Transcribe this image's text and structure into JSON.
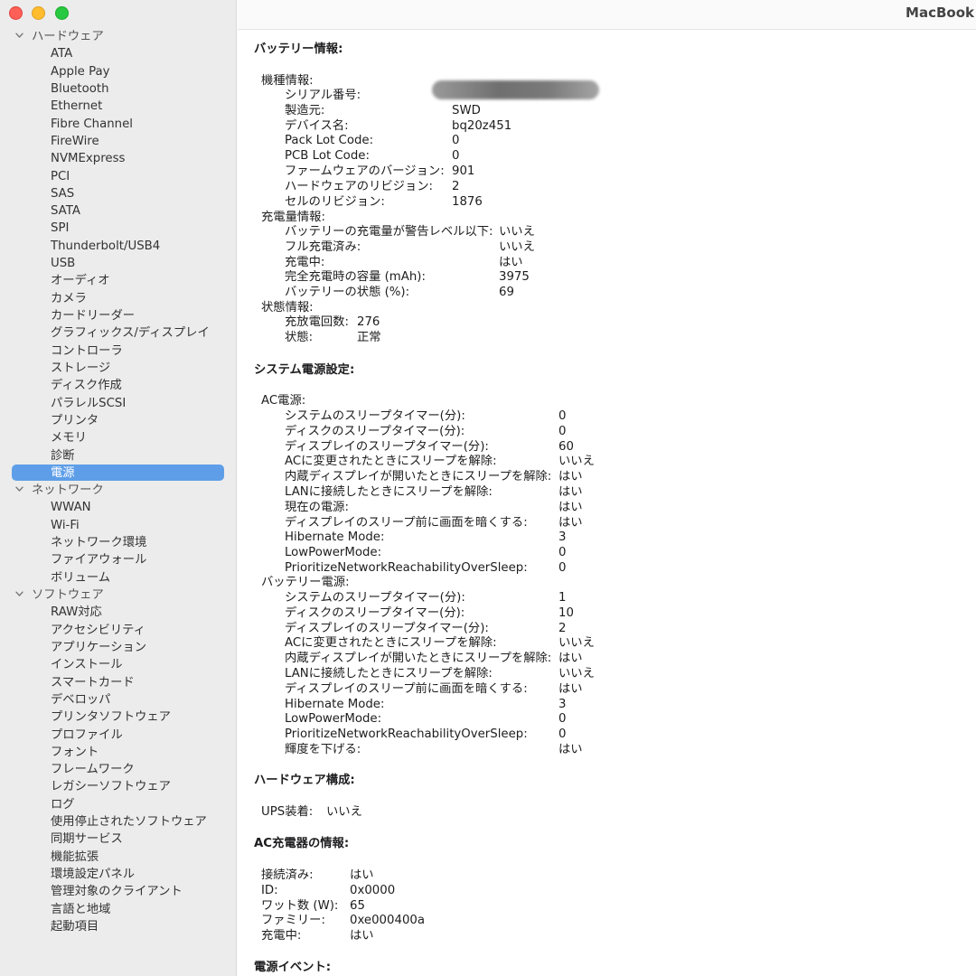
{
  "window": {
    "title": "MacBook"
  },
  "sidebar": {
    "groups": [
      {
        "label": "ハードウェア",
        "items": [
          "ATA",
          "Apple Pay",
          "Bluetooth",
          "Ethernet",
          "Fibre Channel",
          "FireWire",
          "NVMExpress",
          "PCI",
          "SAS",
          "SATA",
          "SPI",
          "Thunderbolt/USB4",
          "USB",
          "オーディオ",
          "カメラ",
          "カードリーダー",
          "グラフィックス/ディスプレイ",
          "コントローラ",
          "ストレージ",
          "ディスク作成",
          "パラレルSCSI",
          "プリンタ",
          "メモリ",
          "診断",
          "電源"
        ]
      },
      {
        "label": "ネットワーク",
        "items": [
          "WWAN",
          "Wi-Fi",
          "ネットワーク環境",
          "ファイアウォール",
          "ボリューム"
        ]
      },
      {
        "label": "ソフトウェア",
        "items": [
          "RAW対応",
          "アクセシビリティ",
          "アプリケーション",
          "インストール",
          "スマートカード",
          "デベロッパ",
          "プリンタソフトウェア",
          "プロファイル",
          "フォント",
          "フレームワーク",
          "レガシーソフトウェア",
          "ログ",
          "使用停止されたソフトウェア",
          "同期サービス",
          "機能拡張",
          "環境設定パネル",
          "管理対象のクライアント",
          "言語と地域",
          "起動項目"
        ]
      }
    ],
    "selected": "電源"
  },
  "battery": {
    "title": "バッテリー情報:",
    "model_header": "機種情報:",
    "model": [
      {
        "k": "シリアル番号:",
        "v": ""
      },
      {
        "k": "製造元:",
        "v": "SWD"
      },
      {
        "k": "デバイス名:",
        "v": "bq20z451"
      },
      {
        "k": "Pack Lot Code:",
        "v": "0"
      },
      {
        "k": "PCB Lot Code:",
        "v": "0"
      },
      {
        "k": "ファームウェアのバージョン:",
        "v": "901"
      },
      {
        "k": "ハードウェアのリビジョン:",
        "v": "2"
      },
      {
        "k": "セルのリビジョン:",
        "v": "1876"
      }
    ],
    "charge_header": "充電量情報:",
    "charge": [
      {
        "k": "バッテリーの充電量が警告レベル以下:",
        "v": "いいえ"
      },
      {
        "k": "フル充電済み:",
        "v": "いいえ"
      },
      {
        "k": "充電中:",
        "v": "はい"
      },
      {
        "k": "完全充電時の容量 (mAh):",
        "v": "3975"
      },
      {
        "k": "バッテリーの状態 (%):",
        "v": "69"
      }
    ],
    "status_header": "状態情報:",
    "status": [
      {
        "k": "充放電回数:",
        "v": "276"
      },
      {
        "k": "状態:",
        "v": "正常"
      }
    ]
  },
  "power": {
    "title": "システム電源設定:",
    "ac_header": "AC電源:",
    "ac": [
      {
        "k": "システムのスリープタイマー(分):",
        "v": "0"
      },
      {
        "k": "ディスクのスリープタイマー(分):",
        "v": "0"
      },
      {
        "k": "ディスプレイのスリープタイマー(分):",
        "v": "60"
      },
      {
        "k": "ACに変更されたときにスリープを解除:",
        "v": "いいえ"
      },
      {
        "k": "内蔵ディスプレイが開いたときにスリープを解除:",
        "v": "はい"
      },
      {
        "k": "LANに接続したときにスリープを解除:",
        "v": "はい"
      },
      {
        "k": "現在の電源:",
        "v": "はい"
      },
      {
        "k": "ディスプレイのスリープ前に画面を暗くする:",
        "v": "はい"
      },
      {
        "k": "Hibernate Mode:",
        "v": "3"
      },
      {
        "k": "LowPowerMode:",
        "v": "0"
      },
      {
        "k": "PrioritizeNetworkReachabilityOverSleep:",
        "v": "0"
      }
    ],
    "batt_header": "バッテリー電源:",
    "batt": [
      {
        "k": "システムのスリープタイマー(分):",
        "v": "1"
      },
      {
        "k": "ディスクのスリープタイマー(分):",
        "v": "10"
      },
      {
        "k": "ディスプレイのスリープタイマー(分):",
        "v": "2"
      },
      {
        "k": "ACに変更されたときにスリープを解除:",
        "v": "いいえ"
      },
      {
        "k": "内蔵ディスプレイが開いたときにスリープを解除:",
        "v": "はい"
      },
      {
        "k": "LANに接続したときにスリープを解除:",
        "v": "いいえ"
      },
      {
        "k": "ディスプレイのスリープ前に画面を暗くする:",
        "v": "はい"
      },
      {
        "k": "Hibernate Mode:",
        "v": "3"
      },
      {
        "k": "LowPowerMode:",
        "v": "0"
      },
      {
        "k": "PrioritizeNetworkReachabilityOverSleep:",
        "v": "0"
      },
      {
        "k": "輝度を下げる:",
        "v": "はい"
      }
    ]
  },
  "hardware": {
    "title": "ハードウェア構成:",
    "ups_label": "UPS装着:",
    "ups_value": "いいえ"
  },
  "charger": {
    "title": "AC充電器の情報:",
    "rows": [
      {
        "k": "接続済み:",
        "v": "はい"
      },
      {
        "k": "ID:",
        "v": "0x0000"
      },
      {
        "k": "ワット数 (W):",
        "v": "65"
      },
      {
        "k": "ファミリー:",
        "v": "0xe000400a"
      },
      {
        "k": "充電中:",
        "v": "はい"
      }
    ]
  },
  "events": {
    "title": "電源イベント:"
  }
}
